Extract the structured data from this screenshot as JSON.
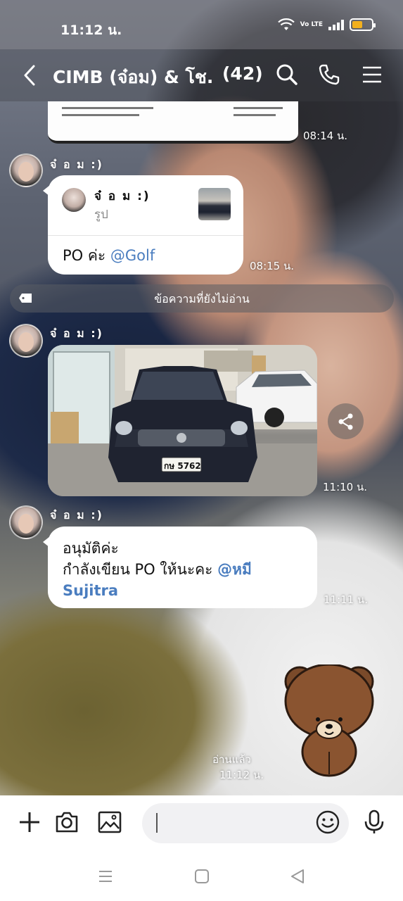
{
  "status": {
    "time": "11:12 น.",
    "battery_color": "#f2b01e",
    "volte_label": "Vo LTE"
  },
  "header": {
    "title": "CIMB (จ๋อม) & โช...",
    "count": "(42)",
    "icons": [
      "back-icon",
      "search-icon",
      "phone-icon",
      "menu-icon"
    ]
  },
  "messages": {
    "first_time": "08:14 น.",
    "reply": {
      "sender": "จ๋ อ ม :)",
      "quote_name": "จ๋ อ ม :)",
      "quote_sub": "รูป",
      "text_prefix": "PO ค่ะ ",
      "mention": "@Golf",
      "time": "08:15 น."
    },
    "unread_divider": "ข้อความที่ยังไม่อ่าน",
    "photo": {
      "sender": "จ๋ อ ม :)",
      "plate": "กษ 5762",
      "time": "11:10 น."
    },
    "approval": {
      "sender": "จ๋ อ ม :)",
      "line1": "อนุมัติค่ะ",
      "line2_prefix": "กำลังเขียน PO ให้นะคะ ",
      "mention_first": "@หมี",
      "mention_second": "Sujitra",
      "time": "11:11 น."
    },
    "sticker": {
      "read_label": "อ่านแล้ว",
      "time": "11:12 น."
    }
  },
  "input_bar": {
    "placeholder": "",
    "icons": [
      "plus-icon",
      "camera-icon",
      "image-icon",
      "emoji-icon",
      "microphone-icon"
    ]
  },
  "nav": {
    "icons": [
      "recents-icon",
      "home-icon",
      "back-nav-icon"
    ]
  },
  "colors": {
    "mention": "#4a7dbf",
    "bubble": "#ffffff"
  }
}
